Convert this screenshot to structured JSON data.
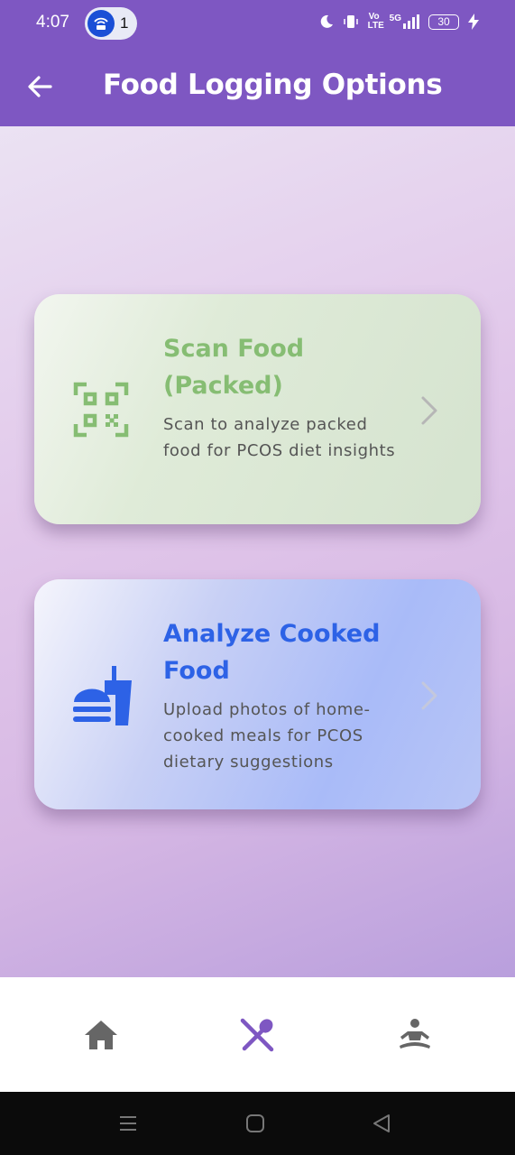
{
  "status_bar": {
    "time": "4:07",
    "notification_count": "1",
    "volte_label": "Vo LTE",
    "network_label": "5G",
    "battery_level": "30"
  },
  "app_bar": {
    "title": "Food Logging Options",
    "background_color": "#7e57c2"
  },
  "options": [
    {
      "title": "Scan Food (Packed)",
      "description": "Scan to analyze packed food for PCOS diet insights",
      "icon": "qr-scan-icon",
      "accent_color": "#86bd73"
    },
    {
      "title": "Analyze Cooked Food",
      "description": "Upload photos of home-cooked meals for PCOS dietary suggestions",
      "icon": "fastfood-icon",
      "accent_color": "#2d62e6"
    }
  ],
  "bottom_nav": {
    "items": [
      {
        "icon": "home-icon",
        "active": false
      },
      {
        "icon": "restaurant-icon",
        "active": true
      },
      {
        "icon": "meditation-icon",
        "active": false
      }
    ],
    "active_color": "#7e57c2",
    "inactive_color": "#666666"
  },
  "system_nav": {
    "items": [
      "recent-apps-icon",
      "home-circle-icon",
      "back-triangle-icon"
    ]
  }
}
